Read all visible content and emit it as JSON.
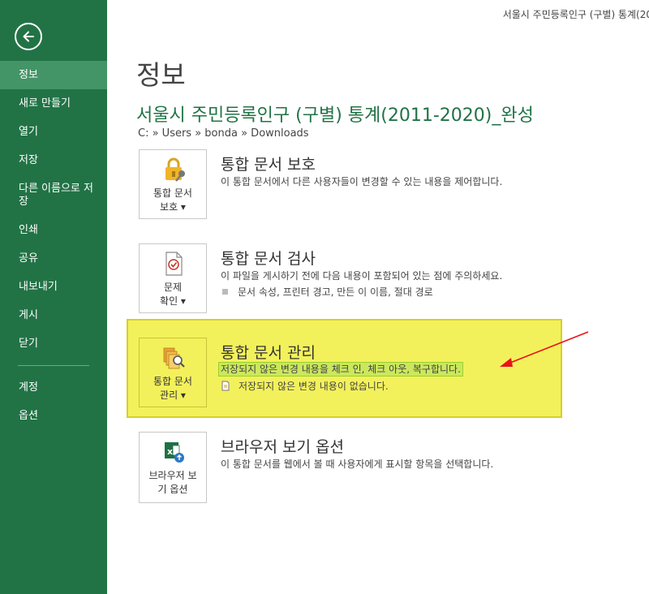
{
  "window": {
    "title": "서울시 주민등록인구 (구별) 통계(20"
  },
  "sidebar": {
    "back_icon": "back-arrow-circle-icon",
    "items": [
      {
        "label": "정보",
        "active": true
      },
      {
        "label": "새로 만들기"
      },
      {
        "label": "열기"
      },
      {
        "label": "저장"
      },
      {
        "label": "다른 이름으로 저장"
      },
      {
        "label": "인쇄"
      },
      {
        "label": "공유"
      },
      {
        "label": "내보내기"
      },
      {
        "label": "게시"
      },
      {
        "label": "닫기"
      }
    ],
    "bottom_items": [
      {
        "label": "계정"
      },
      {
        "label": "옵션"
      }
    ],
    "accent": "#217346"
  },
  "main": {
    "page_title": "정보",
    "doc_title": "서울시 주민등록인구 (구별) 통계(2011-2020)_완성",
    "doc_path": "C: » Users » bonda » Downloads",
    "sections": [
      {
        "tile_label_1": "통합 문서",
        "tile_label_2": "보호 ▾",
        "icon": "lock-key-icon",
        "heading": "통합 문서 보호",
        "description": "이 통합 문서에서 다른 사용자들이 변경할 수 있는 내용을 제어합니다."
      },
      {
        "tile_label_1": "문제",
        "tile_label_2": "확인 ▾",
        "icon": "inspect-document-icon",
        "heading": "통합 문서 검사",
        "description": "이 파일을 게시하기 전에 다음 내용이 포함되어 있는 점에 주의하세요.",
        "bullet": "문서 속성, 프린터 경고, 만든 이 이름, 절대 경로"
      },
      {
        "tile_label_1": "통합 문서",
        "tile_label_2": "관리 ▾",
        "icon": "manage-workbook-icon",
        "heading": "통합 문서 관리",
        "description": "저장되지 않은 변경 내용을 체크 인, 체크 아웃, 복구합니다.",
        "note": "저장되지 않은 변경 내용이 없습니다.",
        "highlight_color": "#f3f15b"
      },
      {
        "tile_label_1": "브라우저 보",
        "tile_label_2": "기 옵션",
        "icon": "browser-view-options-icon",
        "heading": "브라우저 보기 옵션",
        "description": "이 통합 문서를 웹에서 볼 때 사용자에게 표시할 항목을 선택합니다."
      }
    ]
  }
}
